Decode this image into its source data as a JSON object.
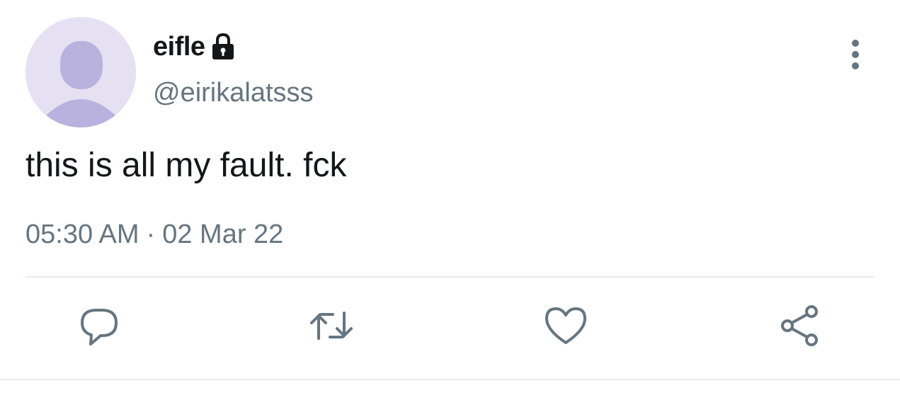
{
  "tweet": {
    "display_name": "eifle",
    "handle": "@eirikalatsss",
    "text": "this is all my fault. fck",
    "time": "05:30 AM",
    "separator": "·",
    "date": "02 Mar 22",
    "is_protected": true
  },
  "icons": {
    "avatar": "default-avatar-icon",
    "lock": "lock-icon",
    "more": "more-options-icon",
    "reply": "reply-icon",
    "retweet": "retweet-icon",
    "like": "like-icon",
    "share": "share-icon"
  },
  "colors": {
    "text": "#14171a",
    "secondary": "#66757f",
    "avatar_bg": "#e6e1f2",
    "avatar_fg": "#b9b2df",
    "divider": "#e6ecf0"
  }
}
